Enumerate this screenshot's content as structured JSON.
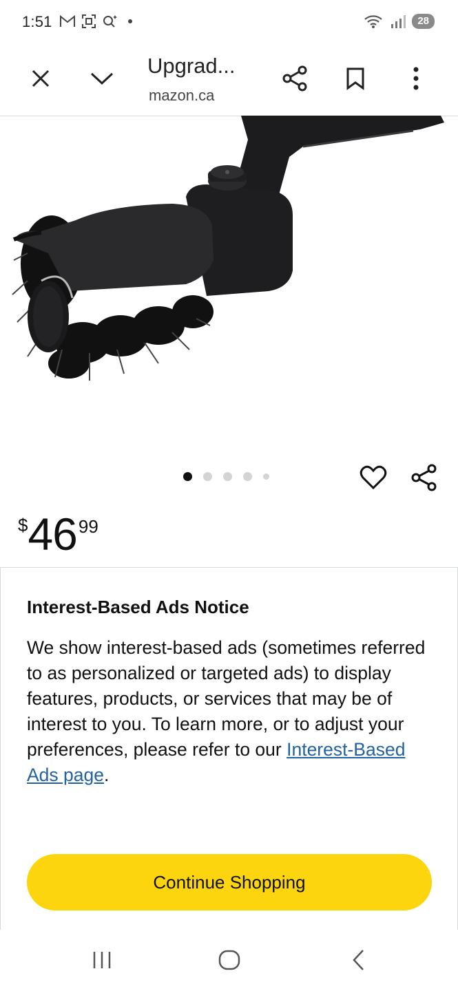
{
  "status_bar": {
    "time": "1:51",
    "left_icons": [
      "gmail-icon",
      "screenshot-icon",
      "search-sparkle-icon",
      "dot"
    ],
    "right_icons": [
      "wifi-icon",
      "signal-icon"
    ],
    "battery": "28"
  },
  "browser": {
    "title": "Upgrad...",
    "url": "mazon.ca",
    "icons": [
      "close-icon",
      "chevron-down-icon",
      "share-icon",
      "bookmark-icon",
      "more-vert-icon"
    ]
  },
  "product": {
    "image_alt_icon": "grill-brush-image",
    "carousel": {
      "count": 5,
      "active_index": 0
    },
    "price": {
      "symbol": "$",
      "whole": "46",
      "fraction": "99"
    }
  },
  "notice": {
    "title": "Interest-Based Ads Notice",
    "body": "We show interest-based ads (sometimes referred to as personalized or targeted ads) to display features, products, or services that may be of interest to you. To learn more, or to adjust your preferences, please refer to our ",
    "link_text": "Interest-Based Ads page",
    "body_end": ".",
    "button_label": "Continue Shopping"
  },
  "colors": {
    "button_yellow": "#fcd50f",
    "link_blue": "#2162a1",
    "text": "#0f1111"
  },
  "nav": [
    "recents-icon",
    "home-icon",
    "back-icon"
  ]
}
